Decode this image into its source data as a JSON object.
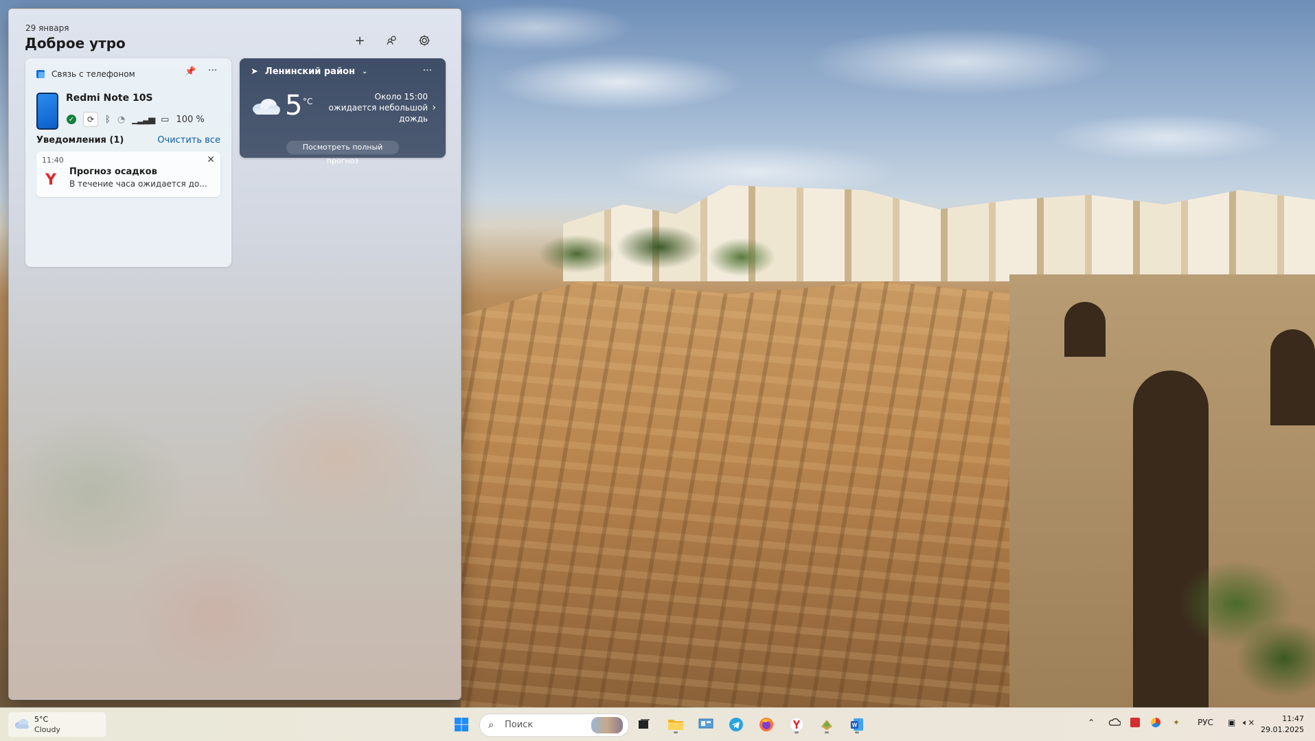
{
  "widgets": {
    "date": "29 января",
    "greeting": "Доброе утро",
    "header_buttons": {
      "add": "+",
      "people_icon": "people-icon",
      "settings_icon": "gear-icon"
    },
    "phone_link": {
      "title": "Связь с телефоном",
      "device_name": "Redmi Note 10S",
      "battery": "100 %",
      "notifications_label": "Уведомления (1)",
      "clear_all": "Очистить все",
      "notification": {
        "time": "11:40",
        "app_logo": "Y",
        "title": "Прогноз осадков",
        "body": "В течение часа ожидается до..."
      }
    },
    "weather": {
      "location": "Ленинский район",
      "temperature": "5",
      "unit": "°C",
      "forecast": "Около 15:00 ожидается небольшой дождь",
      "full_forecast_button": "Посмотреть полный прогноз"
    }
  },
  "taskbar": {
    "weather_temp": "5°C",
    "weather_desc": "Cloudy",
    "search_placeholder": "Поиск",
    "language": "РУС",
    "time": "11:47",
    "date": "29.01.2025"
  },
  "colors": {
    "accent_link": "#0b5ca8",
    "weather_card_bg": "#45536c",
    "yandex_red": "#e3262b",
    "windows_blue": "#1e8bff"
  }
}
